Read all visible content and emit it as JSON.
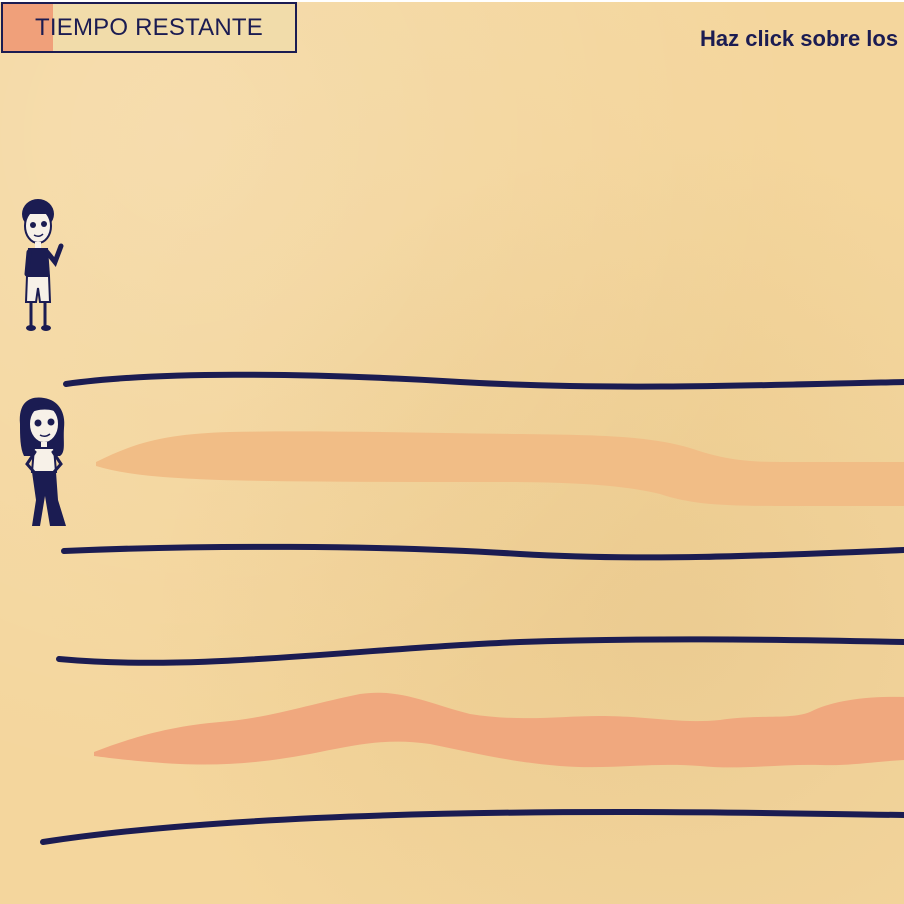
{
  "timer": {
    "label": "TIEMPO RESTANTE",
    "remaining_fraction": 0.17,
    "fill_color": "#f0a07a"
  },
  "instruction": {
    "text": "Haz click sobre los"
  },
  "characters": [
    {
      "icon": "boy-character-icon"
    },
    {
      "icon": "girl-character-icon"
    }
  ],
  "colors": {
    "ink": "#1b1c52",
    "paper": "#f4d69d",
    "paint_light": "#f1bd86",
    "paint_salmon": "#f0a87e"
  }
}
